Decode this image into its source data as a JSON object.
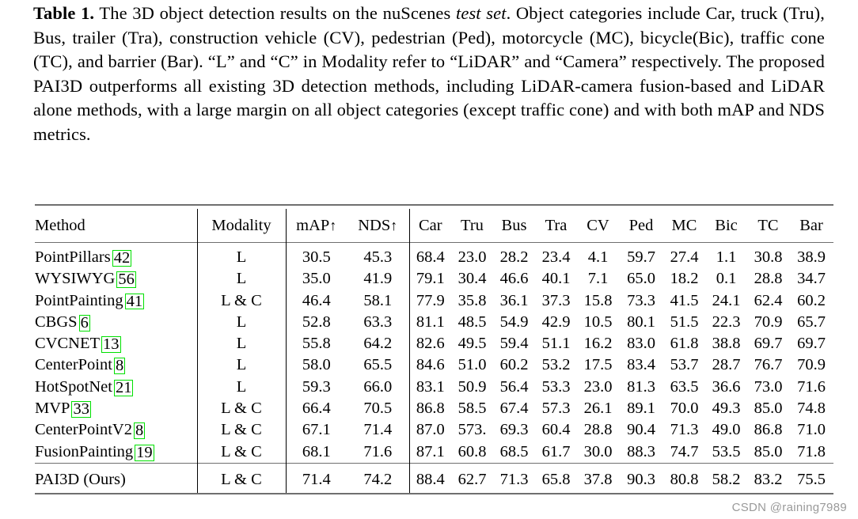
{
  "caption": {
    "label": "Table 1.",
    "part1": "The 3D object detection results on the nuScenes ",
    "italic": "test set",
    "part2": ". Object categories include Car, truck (Tru), Bus, trailer (Tra), construction vehicle (CV), pedestrian (Ped), motorcycle (MC), bicycle(Bic), traffic cone (TC), and barrier (Bar). “L” and “C” in Modality refer to “LiDAR” and “Camera” respectively. The proposed PAI3D outperforms all existing 3D detection methods, including LiDAR-camera fusion-based and LiDAR alone methods, with a large margin on all object categories (except traffic cone) and with both mAP and NDS metrics."
  },
  "table": {
    "headers": {
      "method": "Method",
      "modality": "Modality",
      "map": "mAP",
      "map_arrow": "↑",
      "nds": "NDS",
      "nds_arrow": "↑",
      "car": "Car",
      "tru": "Tru",
      "bus": "Bus",
      "tra": "Tra",
      "cv": "CV",
      "ped": "Ped",
      "mc": "MC",
      "bic": "Bic",
      "tc": "TC",
      "bar": "Bar"
    },
    "rows": [
      {
        "method": "PointPillars",
        "cite": "42",
        "modality": "L",
        "map": "30.5",
        "nds": "45.3",
        "car": "68.4",
        "tru": "23.0",
        "bus": "28.2",
        "tra": "23.4",
        "cv": "4.1",
        "ped": "59.7",
        "mc": "27.4",
        "bic": "1.1",
        "tc": "30.8",
        "bar": "38.9"
      },
      {
        "method": "WYSIWYG",
        "cite": "56",
        "modality": "L",
        "map": "35.0",
        "nds": "41.9",
        "car": "79.1",
        "tru": "30.4",
        "bus": "46.6",
        "tra": "40.1",
        "cv": "7.1",
        "ped": "65.0",
        "mc": "18.2",
        "bic": "0.1",
        "tc": "28.8",
        "bar": "34.7"
      },
      {
        "method": "PointPainting",
        "cite": "41",
        "modality": "L & C",
        "map": "46.4",
        "nds": "58.1",
        "car": "77.9",
        "tru": "35.8",
        "bus": "36.1",
        "tra": "37.3",
        "cv": "15.8",
        "ped": "73.3",
        "mc": "41.5",
        "bic": "24.1",
        "tc": "62.4",
        "bar": "60.2"
      },
      {
        "method": "CBGS",
        "cite": "6",
        "modality": "L",
        "map": "52.8",
        "nds": "63.3",
        "car": "81.1",
        "tru": "48.5",
        "bus": "54.9",
        "tra": "42.9",
        "cv": "10.5",
        "ped": "80.1",
        "mc": "51.5",
        "bic": "22.3",
        "tc": "70.9",
        "bar": "65.7"
      },
      {
        "method": "CVCNET",
        "cite": "13",
        "modality": "L",
        "map": "55.8",
        "nds": "64.2",
        "car": "82.6",
        "tru": "49.5",
        "bus": "59.4",
        "tra": "51.1",
        "cv": "16.2",
        "ped": "83.0",
        "mc": "61.8",
        "bic": "38.8",
        "tc": "69.7",
        "bar": "69.7"
      },
      {
        "method": "CenterPoint",
        "cite": "8",
        "modality": "L",
        "map": "58.0",
        "nds": "65.5",
        "car": "84.6",
        "tru": "51.0",
        "bus": "60.2",
        "tra": "53.2",
        "cv": "17.5",
        "ped": "83.4",
        "mc": "53.7",
        "bic": "28.7",
        "tc": "76.7",
        "bar": "70.9"
      },
      {
        "method": "HotSpotNet",
        "cite": "21",
        "modality": "L",
        "map": "59.3",
        "nds": "66.0",
        "car": "83.1",
        "tru": "50.9",
        "bus": "56.4",
        "tra": "53.3",
        "cv": "23.0",
        "ped": "81.3",
        "mc": "63.5",
        "bic": "36.6",
        "tc": "73.0",
        "bar": "71.6"
      },
      {
        "method": "MVP",
        "cite": "33",
        "modality": "L & C",
        "map": "66.4",
        "nds": "70.5",
        "car": "86.8",
        "tru": "58.5",
        "bus": "67.4",
        "tra": "57.3",
        "cv": "26.1",
        "ped": "89.1",
        "mc": "70.0",
        "bic": "49.3",
        "tc": "85.0",
        "bar": "74.8"
      },
      {
        "method": "CenterPointV2",
        "cite": "8",
        "modality": "L & C",
        "map": "67.1",
        "nds": "71.4",
        "car": "87.0",
        "tru": "573.",
        "bus": "69.3",
        "tra": "60.4",
        "cv": "28.8",
        "ped": "90.4",
        "mc": "71.3",
        "bic": "49.0",
        "tc": "86.8",
        "bar": "71.0",
        "bold_cells": [
          "tc"
        ]
      },
      {
        "method": "FusionPainting",
        "cite": "19",
        "modality": "L & C",
        "map": "68.1",
        "nds": "71.6",
        "car": "87.1",
        "tru": "60.8",
        "bus": "68.5",
        "tra": "61.7",
        "cv": "30.0",
        "ped": "88.3",
        "mc": "74.7",
        "bic": "53.5",
        "tc": "85.0",
        "bar": "71.8"
      },
      {
        "method": "PAI3D (Ours)",
        "cite": "",
        "modality": "L & C",
        "map": "71.4",
        "nds": "74.2",
        "car": "88.4",
        "tru": "62.7",
        "bus": "71.3",
        "tra": "65.8",
        "cv": "37.8",
        "ped": "90.3",
        "mc": "80.8",
        "bic": "58.2",
        "tc": "83.2",
        "bar": "75.5",
        "bold_row": true,
        "non_bold_cells": [
          "tc"
        ]
      }
    ]
  },
  "watermark": "CSDN @raining7989",
  "colors": {
    "cite_box": "#00e000",
    "rule": "#6f6f6f",
    "watermark_text": "#9a9a9a"
  }
}
